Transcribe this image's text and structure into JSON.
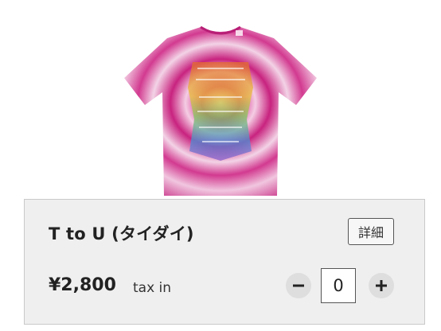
{
  "product": {
    "image_alt": "tie-dye t-shirt",
    "title": "T to U (タイダイ)",
    "details_label": "詳細",
    "price": "¥2,800",
    "tax_label": "tax in",
    "quantity": "0",
    "minus_icon": "minus-icon",
    "plus_icon": "plus-icon"
  },
  "colors": {
    "card_bg": "#efefef",
    "tie_dye_pink": "#d6288a",
    "tie_dye_light": "#f1c6df"
  }
}
